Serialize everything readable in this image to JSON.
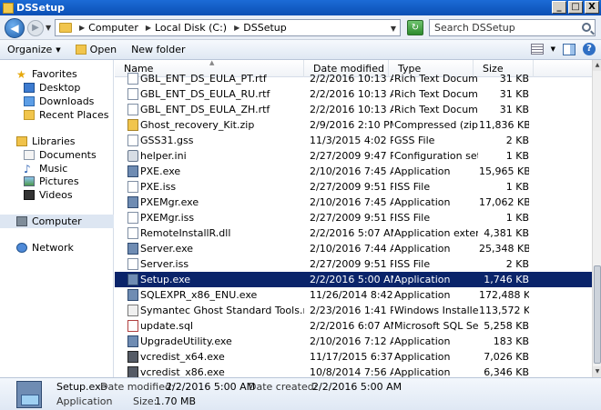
{
  "window": {
    "title": "DSSetup",
    "minimize_glyph": "_",
    "maximize_glyph": "□",
    "close_glyph": "X"
  },
  "address": {
    "crumbs": [
      "Computer",
      "Local Disk (C:)",
      "DSSetup"
    ]
  },
  "search": {
    "placeholder": "Search DSSetup"
  },
  "toolbar": {
    "organize_label": "Organize",
    "open_label": "Open",
    "new_folder_label": "New folder"
  },
  "navigation": {
    "favorites": {
      "label": "Favorites",
      "items": [
        "Desktop",
        "Downloads",
        "Recent Places"
      ]
    },
    "libraries": {
      "label": "Libraries",
      "items": [
        "Documents",
        "Music",
        "Pictures",
        "Videos"
      ]
    },
    "computer_label": "Computer",
    "network_label": "Network"
  },
  "columns": {
    "name": "Name",
    "date": "Date modified",
    "type": "Type",
    "size": "Size"
  },
  "files": [
    {
      "name": "GBL_ENT_DS_EULA_PT.rtf",
      "date": "2/2/2016 10:13 AM",
      "type": "Rich Text Document",
      "size": "31 KB",
      "icon": "doc-icon"
    },
    {
      "name": "GBL_ENT_DS_EULA_RU.rtf",
      "date": "2/2/2016 10:13 AM",
      "type": "Rich Text Document",
      "size": "31 KB",
      "icon": "doc-icon"
    },
    {
      "name": "GBL_ENT_DS_EULA_ZH.rtf",
      "date": "2/2/2016 10:13 AM",
      "type": "Rich Text Document",
      "size": "31 KB",
      "icon": "doc-icon"
    },
    {
      "name": "Ghost_recovery_Kit.zip",
      "date": "2/9/2016 2:10 PM",
      "type": "Compressed (zippe...",
      "size": "11,836 KB",
      "icon": "zip-icon"
    },
    {
      "name": "GSS31.gss",
      "date": "11/3/2015 4:02 PM",
      "type": "GSS File",
      "size": "2 KB",
      "icon": "doc-icon"
    },
    {
      "name": "helper.ini",
      "date": "2/27/2009 9:47 PM",
      "type": "Configuration settings",
      "size": "1 KB",
      "icon": "gear-icon"
    },
    {
      "name": "PXE.exe",
      "date": "2/10/2016 7:45 AM",
      "type": "Application",
      "size": "15,965 KB",
      "icon": "app-icon"
    },
    {
      "name": "PXE.iss",
      "date": "2/27/2009 9:51 PM",
      "type": "ISS File",
      "size": "1 KB",
      "icon": "doc-icon"
    },
    {
      "name": "PXEMgr.exe",
      "date": "2/10/2016 7:45 AM",
      "type": "Application",
      "size": "17,062 KB",
      "icon": "app-icon"
    },
    {
      "name": "PXEMgr.iss",
      "date": "2/27/2009 9:51 PM",
      "type": "ISS File",
      "size": "1 KB",
      "icon": "doc-icon"
    },
    {
      "name": "RemoteInstallR.dll",
      "date": "2/2/2016 5:07 AM",
      "type": "Application extension",
      "size": "4,381 KB",
      "icon": "dll-icon"
    },
    {
      "name": "Server.exe",
      "date": "2/10/2016 7:44 AM",
      "type": "Application",
      "size": "25,348 KB",
      "icon": "app-icon"
    },
    {
      "name": "Server.iss",
      "date": "2/27/2009 9:51 PM",
      "type": "ISS File",
      "size": "2 KB",
      "icon": "doc-icon"
    },
    {
      "name": "Setup.exe",
      "date": "2/2/2016 5:00 AM",
      "type": "Application",
      "size": "1,746 KB",
      "icon": "app-icon",
      "selected": true
    },
    {
      "name": "SQLEXPR_x86_ENU.exe",
      "date": "11/26/2014 8:42 AM",
      "type": "Application",
      "size": "172,488 KB",
      "icon": "app-icon"
    },
    {
      "name": "Symantec Ghost Standard Tools.msi",
      "date": "2/23/2016 1:41 PM",
      "type": "Windows Installer P...",
      "size": "113,572 KB",
      "icon": "msi-icon"
    },
    {
      "name": "update.sql",
      "date": "2/2/2016 6:07 AM",
      "type": "Microsoft SQL Serv...",
      "size": "5,258 KB",
      "icon": "sql-icon"
    },
    {
      "name": "UpgradeUtility.exe",
      "date": "2/10/2016 7:12 AM",
      "type": "Application",
      "size": "183 KB",
      "icon": "app-icon"
    },
    {
      "name": "vcredist_x64.exe",
      "date": "11/17/2015 6:37 AM",
      "type": "Application",
      "size": "7,026 KB",
      "icon": "vc-icon"
    },
    {
      "name": "vcredist_x86.exe",
      "date": "10/8/2014 7:56 AM",
      "type": "Application",
      "size": "6,346 KB",
      "icon": "vc-icon"
    }
  ],
  "details": {
    "filename": "Setup.exe",
    "date_modified_label": "Date modified:",
    "date_modified": "2/2/2016 5:00 AM",
    "date_created_label": "Date created:",
    "date_created": "2/2/2016 5:00 AM",
    "type": "Application",
    "size_label": "Size:",
    "size": "1.70 MB"
  },
  "colors": {
    "selection": "#0a246a",
    "titlebar": "#1c6bd6"
  }
}
